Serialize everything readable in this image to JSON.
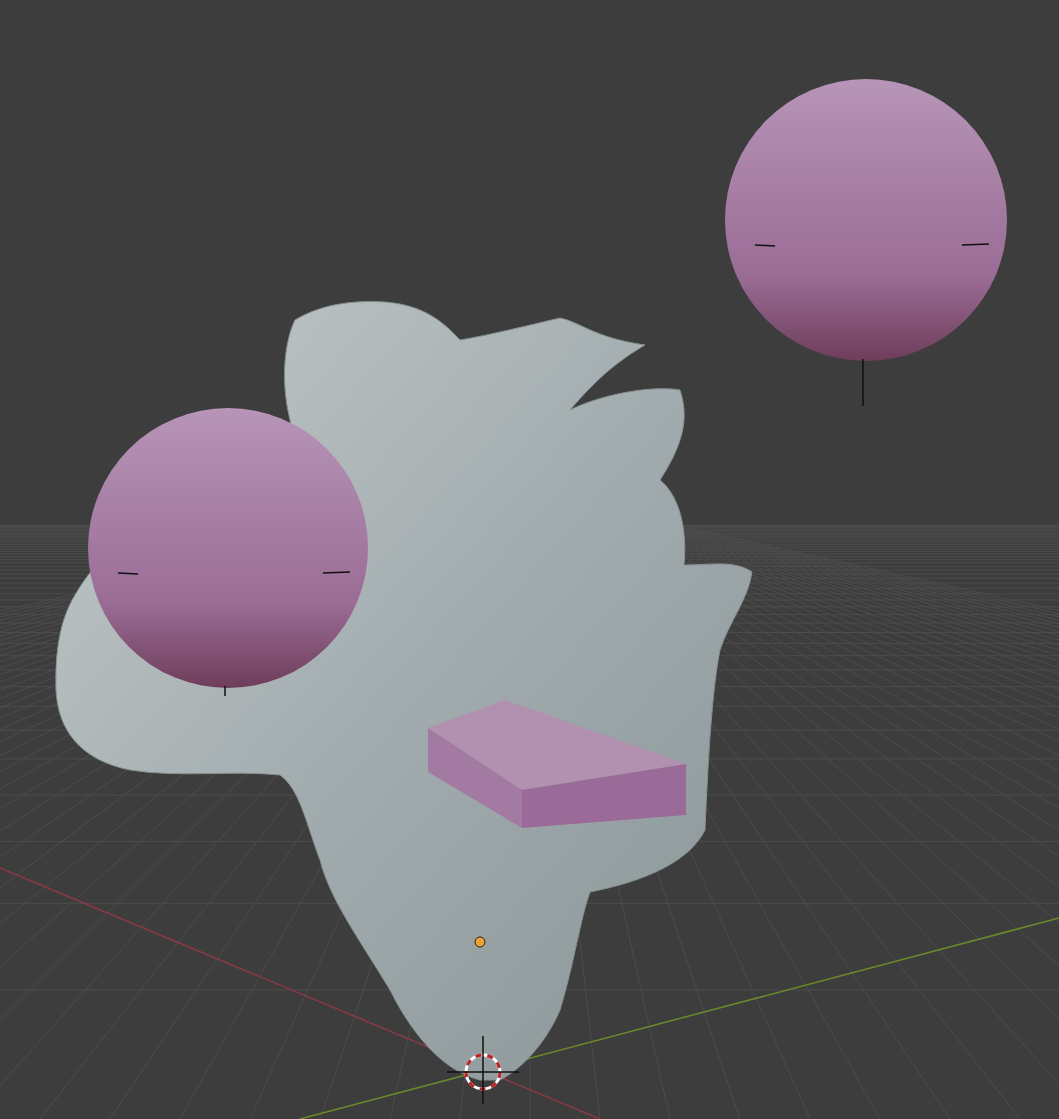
{
  "viewport": {
    "objects": [
      {
        "kind": "sculpt"
      },
      {
        "kind": "sphere"
      },
      {
        "kind": "sphere"
      },
      {
        "kind": "box"
      }
    ]
  }
}
